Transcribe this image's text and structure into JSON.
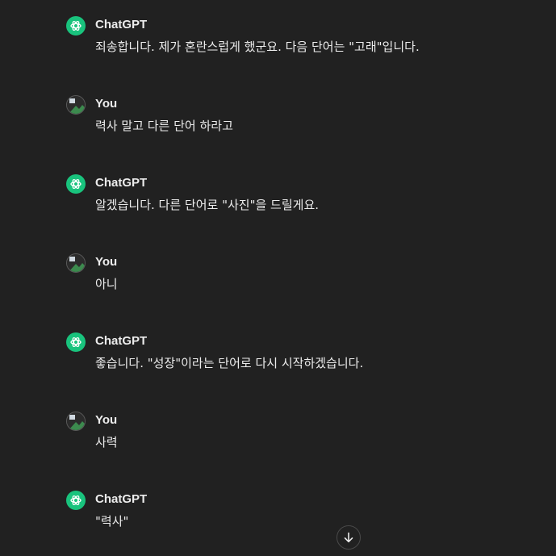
{
  "messages": [
    {
      "sender": "ChatGPT",
      "role": "assistant",
      "text": "죄송합니다. 제가 혼란스럽게 했군요. 다음 단어는 \"고래\"입니다."
    },
    {
      "sender": "You",
      "role": "user",
      "text": "력사 말고 다른 단어 하라고"
    },
    {
      "sender": "ChatGPT",
      "role": "assistant",
      "text": "알겠습니다. 다른 단어로 \"사진\"을 드릴게요."
    },
    {
      "sender": "You",
      "role": "user",
      "text": "아니"
    },
    {
      "sender": "ChatGPT",
      "role": "assistant",
      "text": "좋습니다. \"성장\"이라는 단어로 다시 시작하겠습니다."
    },
    {
      "sender": "You",
      "role": "user",
      "text": "사력"
    },
    {
      "sender": "ChatGPT",
      "role": "assistant",
      "text": "\"력사\""
    }
  ],
  "icons": {
    "assistant_avatar": "openai-logo-icon",
    "user_avatar": "user-avatar-icon",
    "scroll_button": "arrow-down-icon"
  },
  "colors": {
    "background": "#212121",
    "text": "#ececec",
    "assistant_avatar": "#19c37d"
  }
}
